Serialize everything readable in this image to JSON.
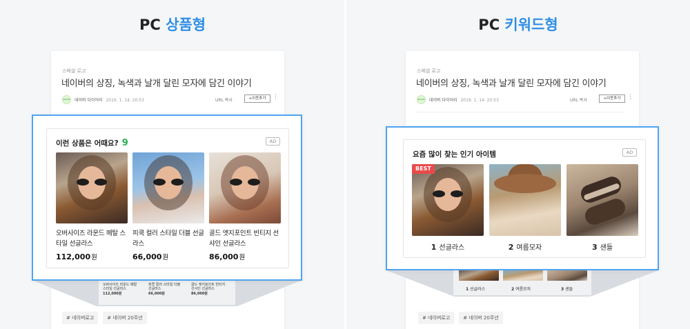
{
  "left": {
    "title_prefix": "PC",
    "title_highlight": "상품형",
    "post": {
      "category": "스페셜 로고",
      "title": "네이버의 상징, 녹색과 날개 달린 모자에 담긴 이야기",
      "avatar_text": "NAVER",
      "author": "네이버 다이어리",
      "date": "2019. 1. 14. 20:53",
      "url_copy": "URL 복사",
      "add_neighbor": "+이웃추가",
      "more": "⋮"
    },
    "ad": {
      "heading": "이런 상품은 어때요?",
      "count": "9",
      "badge": "AD",
      "products": [
        {
          "name": "오버사이즈 라운드 메탈 스타일 선글라스",
          "price": "112,000",
          "won": "원"
        },
        {
          "name": "피쿡 컬러 스타일 더블 선글라스",
          "price": "66,000",
          "won": "원"
        },
        {
          "name": "골드 엣지포인트 빈티지 선샤인 선글라스",
          "price": "86,000",
          "won": "원"
        }
      ]
    },
    "mini": [
      {
        "name1": "오버사이즈 라운드 메탈",
        "name2": "스타일 선글라스",
        "price": "112,000원"
      },
      {
        "name1": "피쿡 컬러 스타일 더블",
        "name2": "선글라스",
        "price": "66,000원"
      },
      {
        "name1": "골드 엣지포인트 빈티지",
        "name2": "선샤인 선글라스",
        "price": "86,000원"
      }
    ],
    "tags": [
      "# 네이버로고",
      "# 네이버 20주년"
    ]
  },
  "right": {
    "title_prefix": "PC",
    "title_highlight": "키워드형",
    "post": {
      "category": "스페셜 로고",
      "title": "네이버의 상징, 녹색과 날개 달린 모자에 담긴 이야기",
      "avatar_text": "NAVER",
      "author": "네이버 다이어리",
      "date": "2019. 1. 14. 20:53",
      "url_copy": "URL 복사",
      "add_neighbor": "+이웃추가",
      "more": "⋮"
    },
    "ad": {
      "heading": "요즘 많이 찾는 인기 아이템",
      "badge": "AD",
      "best": "BEST",
      "keywords": [
        {
          "rank": "1",
          "label": "선글라스"
        },
        {
          "rank": "2",
          "label": "여름모자"
        },
        {
          "rank": "3",
          "label": "샌들"
        }
      ]
    },
    "mini": [
      {
        "rank": "1",
        "label": "선글라스"
      },
      {
        "rank": "2",
        "label": "여름모자"
      },
      {
        "rank": "3",
        "label": "샌들"
      }
    ],
    "tags": [
      "# 네이버로고",
      "# 네이버 20주년"
    ]
  },
  "colors": {
    "accent": "#2f8ee6",
    "frame": "#4ea3f0",
    "count": "#21b049",
    "best": "#e94a4a"
  }
}
